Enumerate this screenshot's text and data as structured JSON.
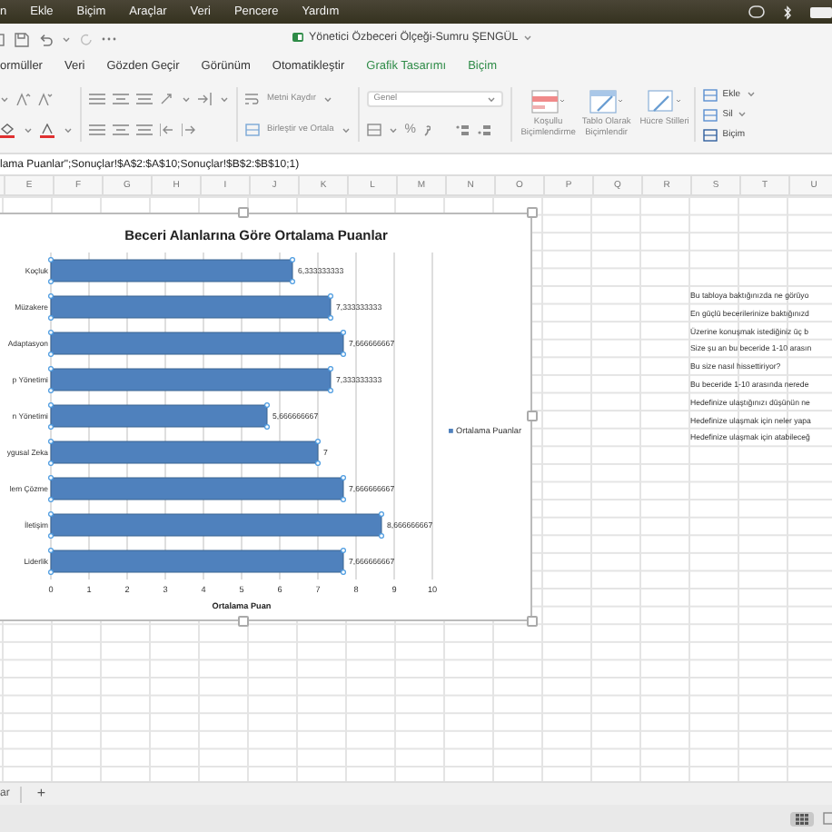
{
  "menu_bar": {
    "items": [
      "n",
      "Ekle",
      "Biçim",
      "Araçlar",
      "Veri",
      "Pencere",
      "Yardım"
    ]
  },
  "window": {
    "title": "Yönetici Özbeceri Ölçeği-Sumru ŞENGÜL"
  },
  "tabs": [
    {
      "label": "ormüller",
      "contextual": false
    },
    {
      "label": "Veri",
      "contextual": false
    },
    {
      "label": "Gözden Geçir",
      "contextual": false
    },
    {
      "label": "Görünüm",
      "contextual": false
    },
    {
      "label": "Otomatikleştir",
      "contextual": false
    },
    {
      "label": "Grafik Tasarımı",
      "contextual": true
    },
    {
      "label": "Biçim",
      "contextual": true
    }
  ],
  "ribbon": {
    "wrap_text": "Metni Kaydır",
    "merge_center": "Birleştir ve Ortala",
    "number_format": "Genel",
    "percent": "%",
    "conditional_format": "Koşullu Biçimlendirme",
    "format_as_table": "Tablo Olarak Biçimlendir",
    "cell_styles": "Hücre Stilleri",
    "insert": "Ekle",
    "delete": "Sil",
    "format": "Biçim"
  },
  "formula_bar": {
    "value": "lama Puanlar\";Sonuçlar!$A$2:$A$10;Sonuçlar!$B$2:$B$10;1)"
  },
  "columns": [
    "E",
    "F",
    "G",
    "H",
    "I",
    "J",
    "K",
    "L",
    "M",
    "N",
    "O",
    "P",
    "Q",
    "R",
    "S",
    "T",
    "U"
  ],
  "chart": {
    "chart_data": {
      "type": "bar",
      "orientation": "horizontal",
      "title": "Beceri Alanlarına Göre Ortalama Puanlar",
      "xlabel": "Ortalama Puan",
      "categories": [
        "Koçluk",
        "Müzakere",
        "Adaptasyon",
        "p Yönetimi",
        "n Yönetimi",
        "ygusal Zeka",
        "lem Çözme",
        "İletişim",
        "Liderlik"
      ],
      "series": [
        {
          "name": "Ortalama Puanlar",
          "color": "#4f81bd",
          "values": [
            6.333333333,
            7.333333333,
            7.666666667,
            7.333333333,
            5.666666667,
            7,
            7.666666667,
            8.666666667,
            7.666666667
          ]
        }
      ],
      "value_labels": [
        "6,333333333",
        "7,333333333",
        "7,666666667",
        "7,333333333",
        "5,666666667",
        "7",
        "7,666666667",
        "8,666666667",
        "7,666666667"
      ],
      "grid": true,
      "xlim": [
        0,
        10
      ],
      "xticks": [
        0,
        1,
        2,
        3,
        4,
        5,
        6,
        7,
        8,
        9,
        10
      ]
    }
  },
  "cells": [
    "Bu tabloya baktığınızda ne görüyo",
    "En güçlü becerilerinize baktığınızd",
    "Üzerine konuşmak istediğiniz üç b",
    "Size şu an bu beceride 1-10 arasın",
    "Bu size nasıl hissettiriyor?",
    "Bu beceride 1-10 arasında nerede",
    "Hedefinize ulaştığınızı düşünün ne",
    "Hedefinize ulaşmak için neler yapa",
    "Hedefinize ulaşmak için atabileceğ"
  ],
  "sheet_tabs": [
    {
      "label": "ar"
    }
  ],
  "add_sheet": "+"
}
